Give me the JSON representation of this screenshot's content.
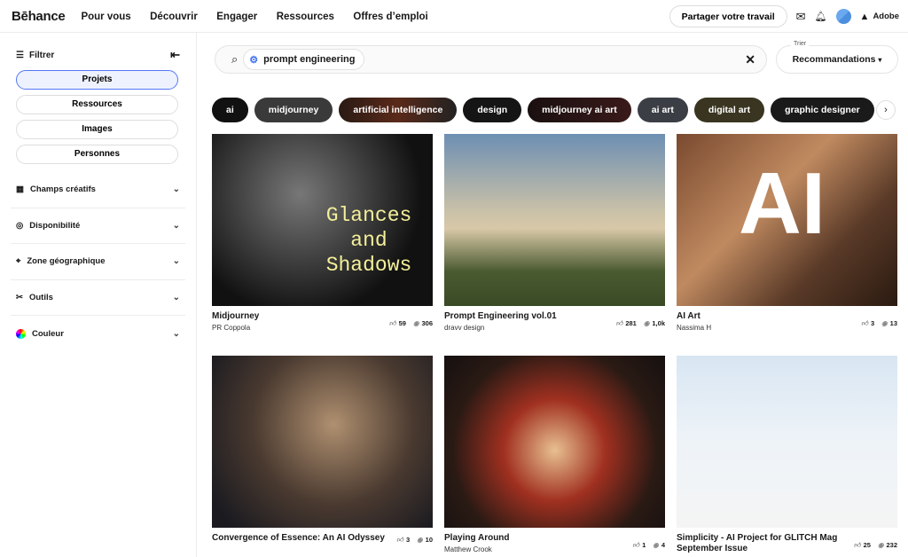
{
  "header": {
    "logo": "Bēhance",
    "nav": [
      "Pour vous",
      "Découvrir",
      "Engager",
      "Ressources",
      "Offres d’emploi"
    ],
    "share": "Partager votre travail",
    "adobe": "Adobe"
  },
  "sidebar": {
    "filter": "Filtrer",
    "types": [
      {
        "label": "Projets",
        "active": true
      },
      {
        "label": "Ressources"
      },
      {
        "label": "Images"
      },
      {
        "label": "Personnes"
      }
    ],
    "sections": [
      {
        "label": "Champs créatifs",
        "icon": "grid-icon"
      },
      {
        "label": "Disponibilité",
        "icon": "person-icon"
      },
      {
        "label": "Zone géographique",
        "icon": "location-icon"
      },
      {
        "label": "Outils",
        "icon": "tools-icon"
      },
      {
        "label": "Couleur",
        "icon": "color-wheel-icon"
      }
    ]
  },
  "search": {
    "query": "prompt engineering"
  },
  "sort": {
    "label": "Trier",
    "value": "Recommandations"
  },
  "tags": [
    "ai",
    "midjourney",
    "artificial intelligence",
    "design",
    "midjourney ai art",
    "ai art",
    "digital art",
    "graphic designer"
  ],
  "projects": [
    {
      "title": "Midjourney",
      "author": "PR Coppola",
      "likes": "59",
      "views": "306",
      "overlay": "Glances and Shadows"
    },
    {
      "title": "Prompt Engineering vol.01",
      "author": "dravv design",
      "likes": "281",
      "views": "1,0k"
    },
    {
      "title": "AI Art",
      "author": "Nassima H",
      "likes": "3",
      "views": "13",
      "overlay": "AI"
    },
    {
      "title": "Convergence of Essence: An AI Odyssey",
      "author": "",
      "likes": "3",
      "views": "10"
    },
    {
      "title": "Playing Around",
      "author": "Matthew Crook",
      "likes": "1",
      "views": "4"
    },
    {
      "title": "Simplicity - AI Project for GLITCH Mag September Issue",
      "author": "",
      "likes": "25",
      "views": "232"
    }
  ]
}
